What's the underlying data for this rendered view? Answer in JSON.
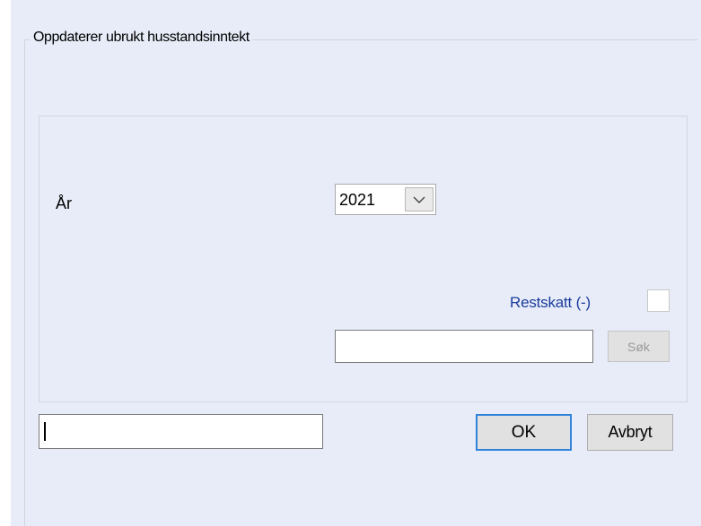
{
  "group": {
    "title": "Oppdaterer ubrukt husstandsinntekt"
  },
  "year": {
    "label": "År",
    "selected": "2021"
  },
  "restskatt": {
    "label": "Restskatt (-)",
    "checked": false
  },
  "search": {
    "value": "",
    "button_label": "Søk"
  },
  "bottom_input": {
    "value": ""
  },
  "buttons": {
    "ok_label": "OK",
    "cancel_label": "Avbryt"
  },
  "colors": {
    "dialog_background": "#e7ecf8",
    "label_blue": "#1a3b9c",
    "focus_border": "#2f82d9"
  },
  "icons": {
    "combo_dropdown": "chevron-down-icon"
  }
}
